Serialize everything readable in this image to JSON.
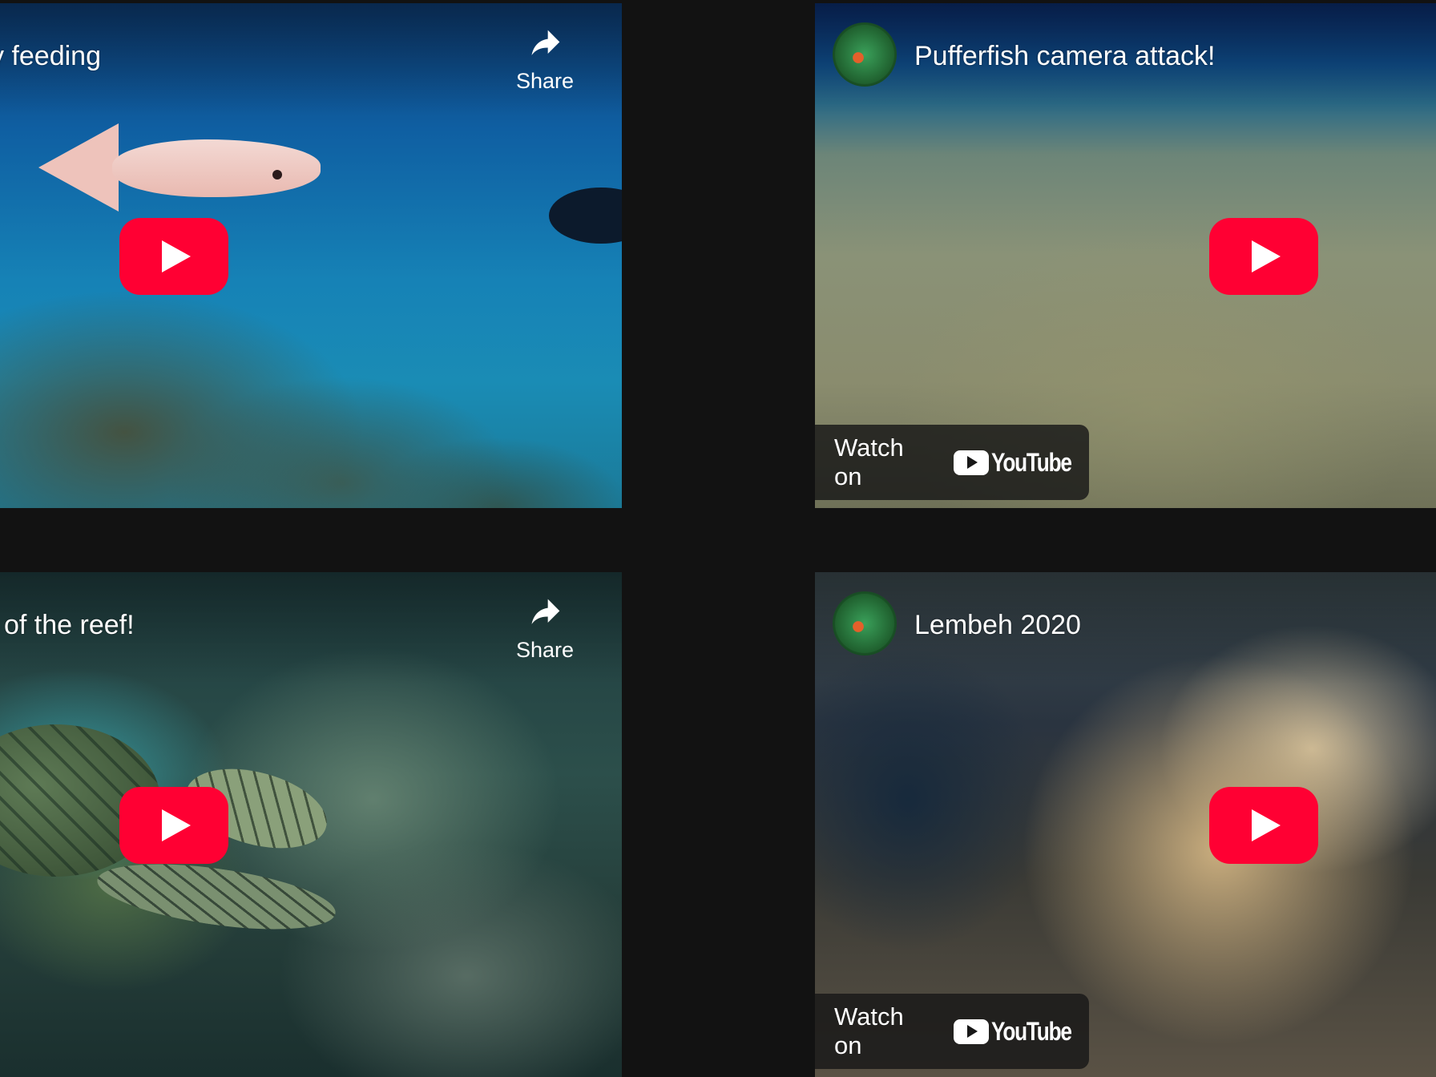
{
  "videos": [
    {
      "title": "y feeding",
      "share_label": "Share"
    },
    {
      "title": "Pufferfish camera attack!",
      "watch_on_label": "Watch on",
      "youtube_label": "YouTube"
    },
    {
      "title": "l of the reef!",
      "share_label": "Share"
    },
    {
      "title": "Lembeh 2020",
      "watch_on_label": "Watch on",
      "youtube_label": "YouTube"
    }
  ],
  "colors": {
    "page_background": "#121212",
    "play_button": "#ff0033",
    "watch_on_bar": "#171717"
  },
  "icons": {
    "share": "share-arrow-icon",
    "play": "play-icon",
    "youtube": "youtube-logo-icon"
  }
}
